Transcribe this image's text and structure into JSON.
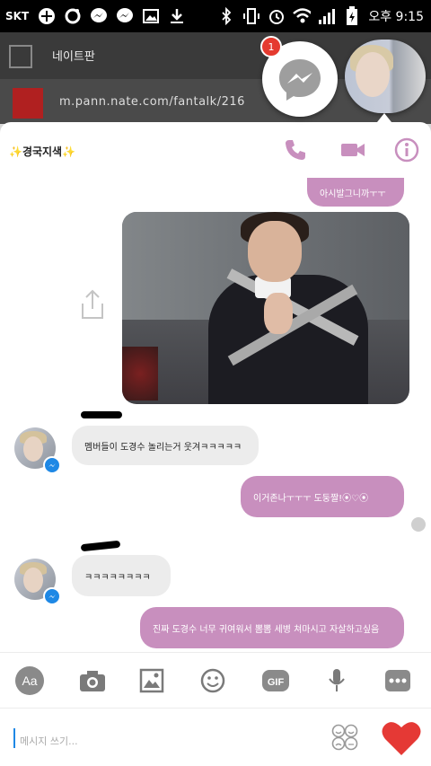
{
  "status_bar": {
    "carrier": "SKT",
    "time": "오후 9:15",
    "icons": [
      "add-icon",
      "circle-icon",
      "messenger-icon",
      "messenger-icon",
      "gallery-icon",
      "download-icon",
      "bluetooth-icon",
      "vibrate-icon",
      "alarm-icon",
      "wifi-icon",
      "signal-icon",
      "battery-icon"
    ]
  },
  "browser_underlay": {
    "title": "네이트판",
    "url": "m.pann.nate.com/fantalk/216"
  },
  "chat_heads": {
    "badge_count": "1"
  },
  "chat": {
    "title": "✨경국지색✨",
    "messages": [
      {
        "direction": "out",
        "text": "아시발그니까ㅜㅜ"
      },
      {
        "direction": "in",
        "text": "멤버들이 도경수 놀리는거 웃겨ㅋㅋㅋㅋㅋ"
      },
      {
        "direction": "out",
        "text": "이거존나ㅜㅜㅜ 도둥짤!⦿♡⦿"
      },
      {
        "direction": "in",
        "text": "ㅋㅋㅋㅋㅋㅋㅋㅋ"
      },
      {
        "direction": "out",
        "text": "진짜 도경수 너무 귀여워서 뽐뽐 세병 쳐마시고 자살하고싶음"
      }
    ],
    "composer_placeholder": "메시지 쓰기...",
    "toolbar": [
      "Aa",
      "camera",
      "gallery",
      "emoji",
      "GIF",
      "microphone",
      "more"
    ]
  },
  "colors": {
    "accent": "#c88fbe",
    "incoming_bubble": "#ececec",
    "messenger_blue": "#1e88e5",
    "heart": "#e53935"
  }
}
